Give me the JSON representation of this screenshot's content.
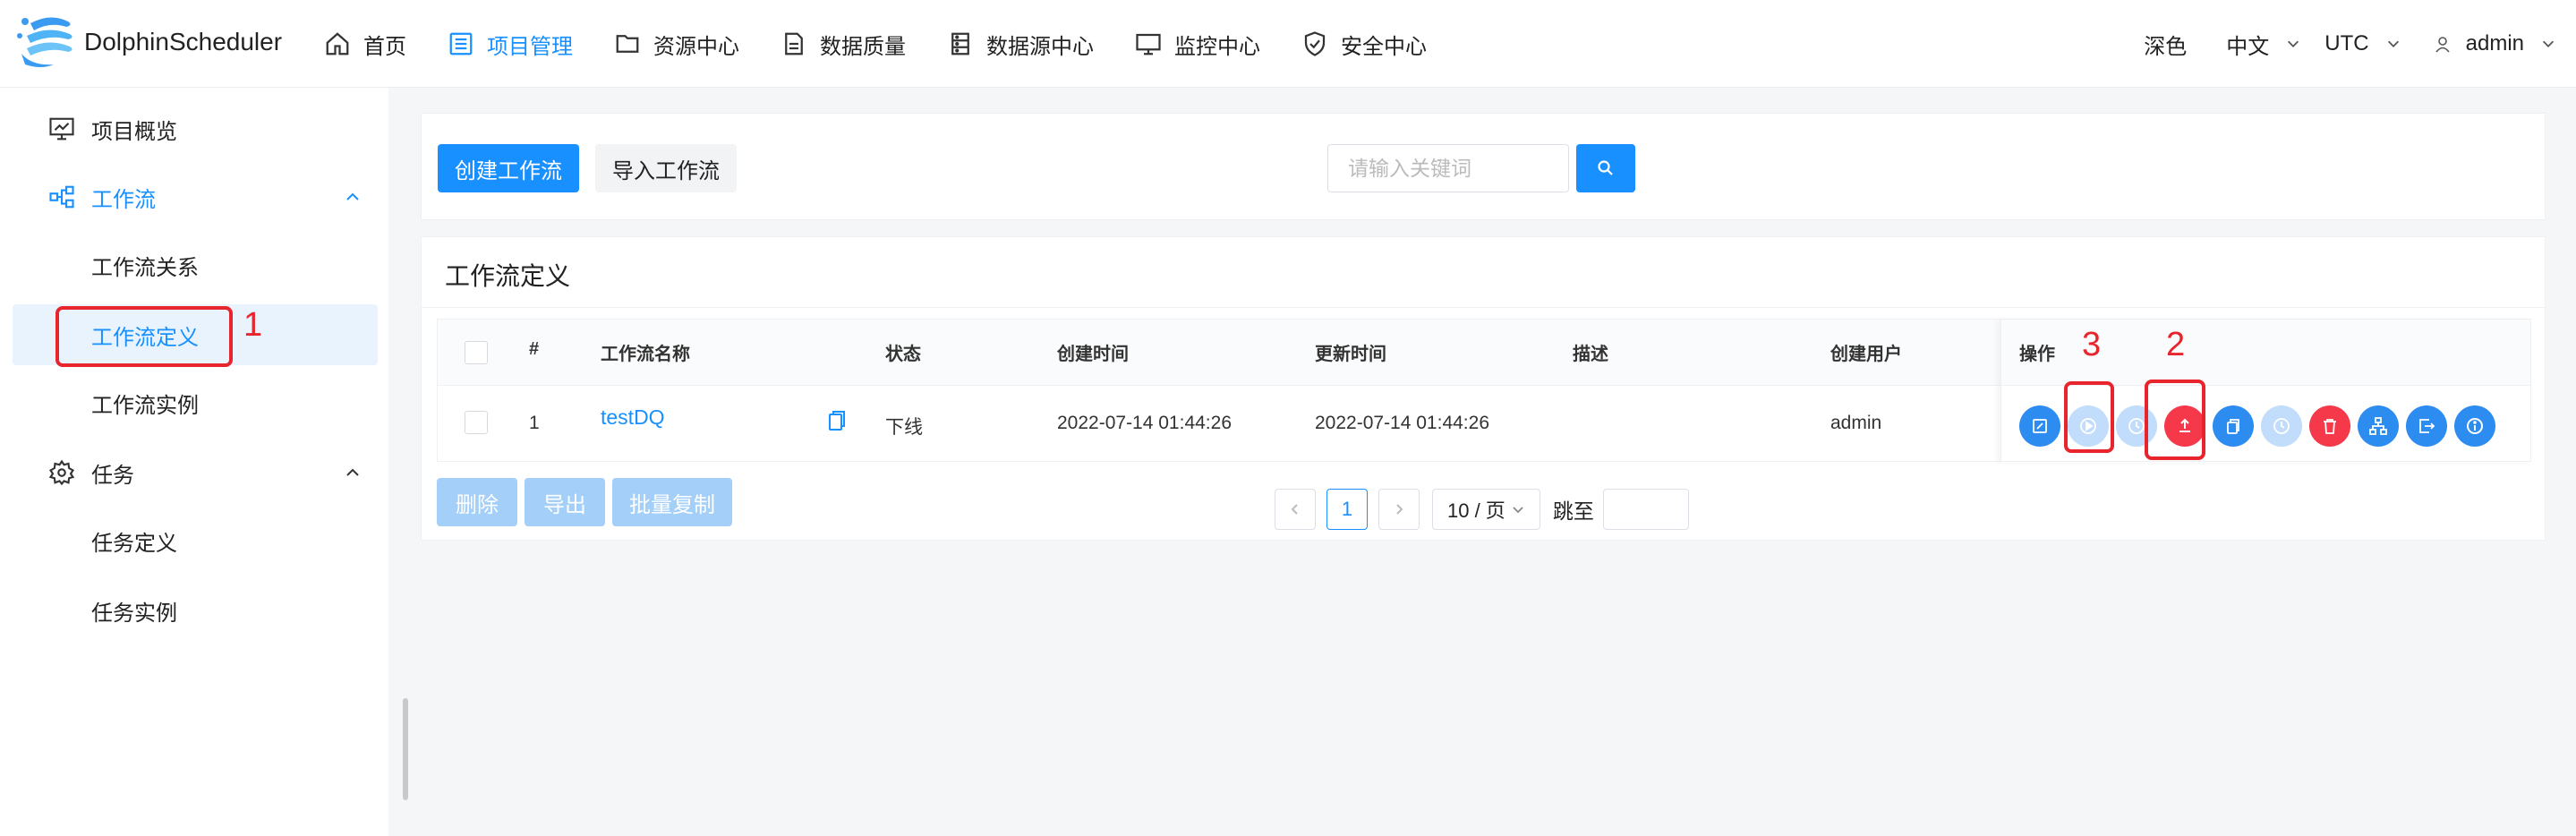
{
  "header": {
    "brand": "DolphinScheduler",
    "nav": [
      {
        "label": "首页",
        "icon": "home-icon"
      },
      {
        "label": "项目管理",
        "icon": "project-list-icon",
        "active": true
      },
      {
        "label": "资源中心",
        "icon": "folder-icon"
      },
      {
        "label": "数据质量",
        "icon": "document-icon"
      },
      {
        "label": "数据源中心",
        "icon": "server-icon"
      },
      {
        "label": "监控中心",
        "icon": "monitor-icon"
      },
      {
        "label": "安全中心",
        "icon": "shield-icon"
      }
    ],
    "theme": "深色",
    "language": "中文",
    "timezone": "UTC",
    "user": "admin"
  },
  "sidebar": {
    "overview": "项目概览",
    "workflow": "工作流",
    "workflow_relation": "工作流关系",
    "workflow_definition": "工作流定义",
    "workflow_instance": "工作流实例",
    "task": "任务",
    "task_definition": "任务定义",
    "task_instance": "任务实例"
  },
  "toolbar": {
    "create_label": "创建工作流",
    "import_label": "导入工作流",
    "search_placeholder": "请输入关键词"
  },
  "table_card": {
    "title": "工作流定义",
    "columns": [
      "#",
      "工作流名称",
      "状态",
      "创建时间",
      "更新时间",
      "描述",
      "创建用户",
      "操作"
    ],
    "rows": [
      {
        "index": "1",
        "name": "testDQ",
        "status": "下线",
        "created": "2022-07-14 01:44:26",
        "updated": "2022-07-14 01:44:26",
        "description": "",
        "user": "admin"
      }
    ],
    "bulk": {
      "delete": "删除",
      "export": "导出",
      "batch_copy": "批量复制"
    },
    "pagination": {
      "page": "1",
      "page_size": "10 / 页",
      "jump_label": "跳至"
    }
  },
  "annotations": [
    "1",
    "2",
    "3"
  ],
  "colors": {
    "primary": "#1890ff",
    "danger": "#f5394a",
    "annotation": "#e8242c"
  }
}
